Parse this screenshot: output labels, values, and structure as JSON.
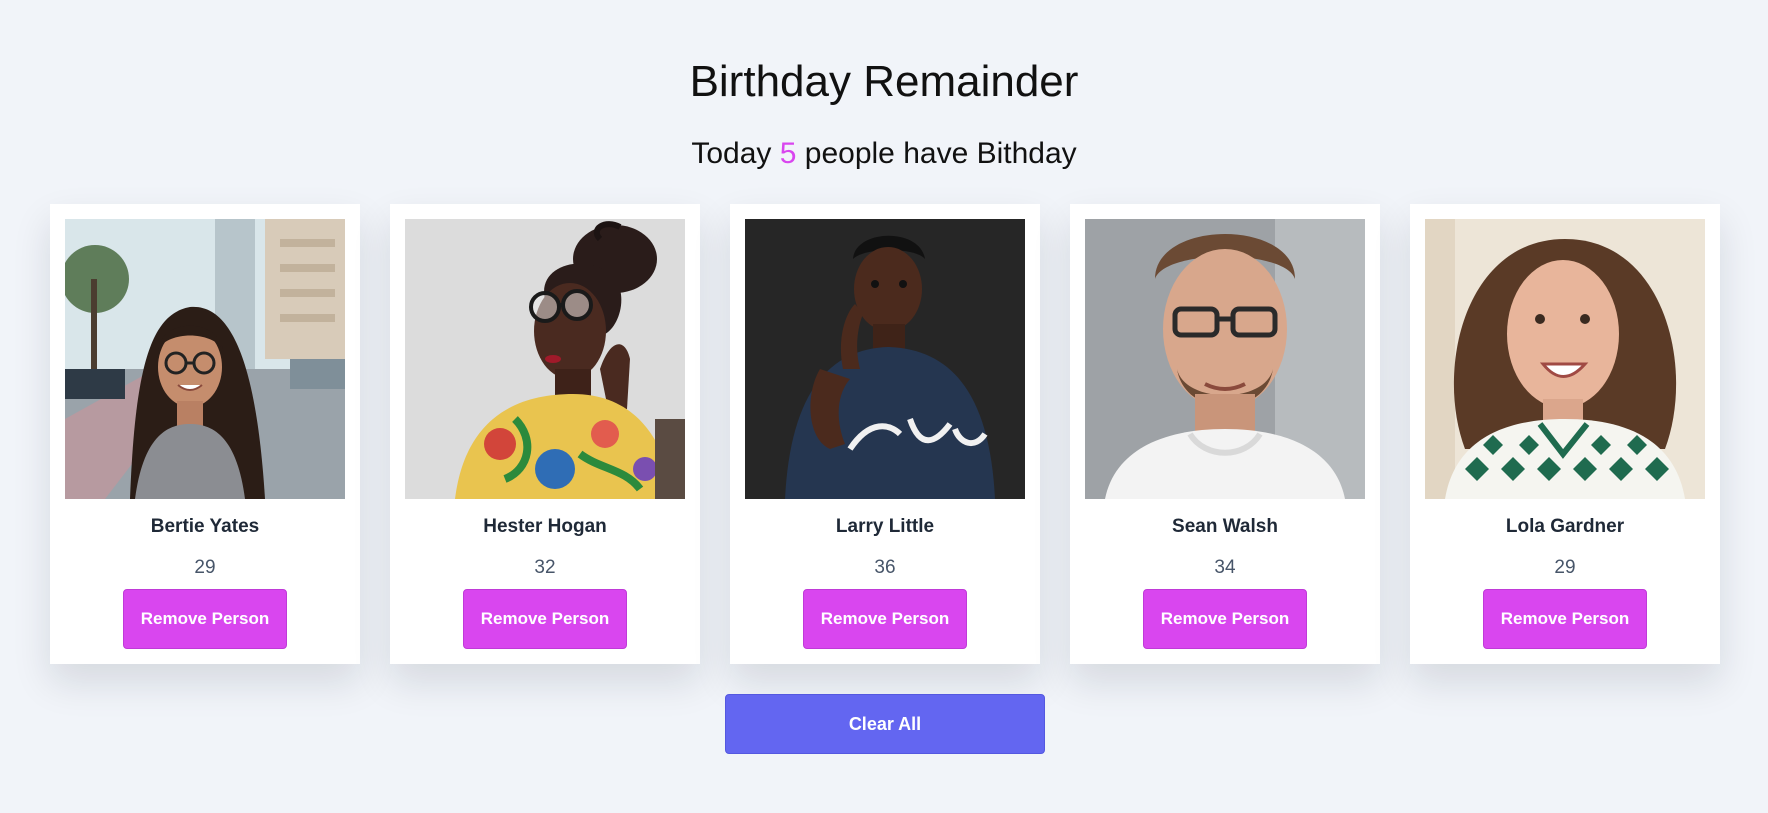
{
  "header": {
    "title": "Birthday Remainder",
    "subtitle_prefix": "Today",
    "count": "5",
    "subtitle_suffix": "people have Bithday"
  },
  "people": [
    {
      "name": "Bertie Yates",
      "age": "29",
      "button_label": "Remove Person"
    },
    {
      "name": "Hester Hogan",
      "age": "32",
      "button_label": "Remove Person"
    },
    {
      "name": "Larry Little",
      "age": "36",
      "button_label": "Remove Person"
    },
    {
      "name": "Sean Walsh",
      "age": "34",
      "button_label": "Remove Person"
    },
    {
      "name": "Lola Gardner",
      "age": "29",
      "button_label": "Remove Person"
    }
  ],
  "footer": {
    "clear_label": "Clear All"
  },
  "colors": {
    "background": "#f1f4f9",
    "accent": "#d946ef",
    "primary_button": "#6366f1",
    "card": "#ffffff"
  }
}
